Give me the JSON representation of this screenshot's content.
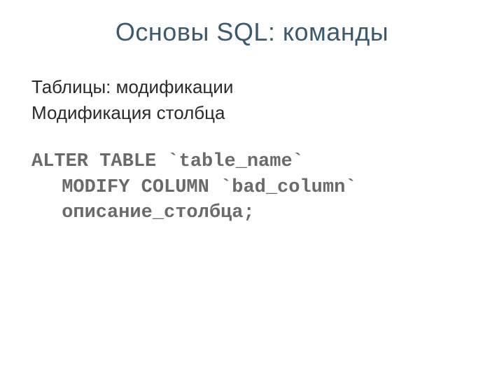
{
  "slide": {
    "title": "Основы SQL: команды",
    "body": {
      "line1": "Таблицы: модификации",
      "line2": "Модификация столбца"
    },
    "code": {
      "line1": "ALTER TABLE `table_name`",
      "line2": "  MODIFY COLUMN `bad_column`",
      "line3": "  описание_столбца;"
    }
  }
}
